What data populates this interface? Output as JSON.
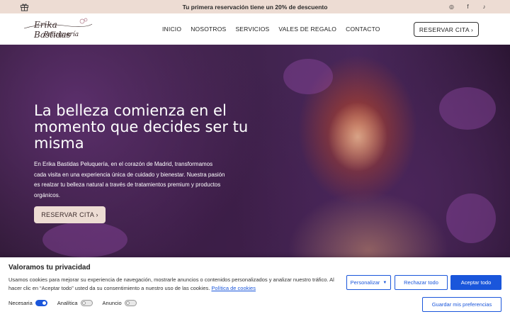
{
  "promo": {
    "text": "Tu primera reservación tiene un 20% de descuento",
    "gift_icon": "gift-icon",
    "socials": [
      {
        "icon": "instagram-icon",
        "glyph": "◎"
      },
      {
        "icon": "facebook-icon",
        "glyph": "f"
      },
      {
        "icon": "tiktok-icon",
        "glyph": "♪"
      }
    ]
  },
  "header": {
    "logo_line1": "Erika Bastidas",
    "logo_line2": "Peluquería",
    "nav": [
      "INICIO",
      "NOSOTROS",
      "SERVICIOS",
      "VALES DE REGALO",
      "CONTACTO"
    ],
    "cta": "RESERVAR CITA ›"
  },
  "hero": {
    "title": "La belleza comienza en el momento que decides ser tu misma",
    "description": "En Erika Bastidas Peluquería, en el corazón de Madrid, transformamos cada visita en una experiencia única de cuidado y bienestar. Nuestra pasión es realzar tu belleza natural a través de tratamientos premium y productos orgánicos.",
    "cta": "RESERVAR CITA ›"
  },
  "cookie": {
    "title": "Valoramos tu privacidad",
    "body": "Usamos cookies para mejorar su experiencia de navegación, mostrarle anuncios o contenidos personalizados y analizar nuestro tráfico. Al hacer clic en “Aceptar todo” usted da su consentimiento a nuestro uso de las cookies.",
    "policy_link": "Política de cookies",
    "toggles": [
      {
        "label": "Necesaria",
        "on": true
      },
      {
        "label": "Analítica",
        "on": false
      },
      {
        "label": "Anuncio",
        "on": false
      }
    ],
    "customize": "Personalizar",
    "reject": "Rechazar todo",
    "accept": "Aceptar todo",
    "save": "Guardar mis preferencias"
  },
  "colors": {
    "accent_blue": "#1a56db",
    "promo_bg": "#eddcd3"
  }
}
